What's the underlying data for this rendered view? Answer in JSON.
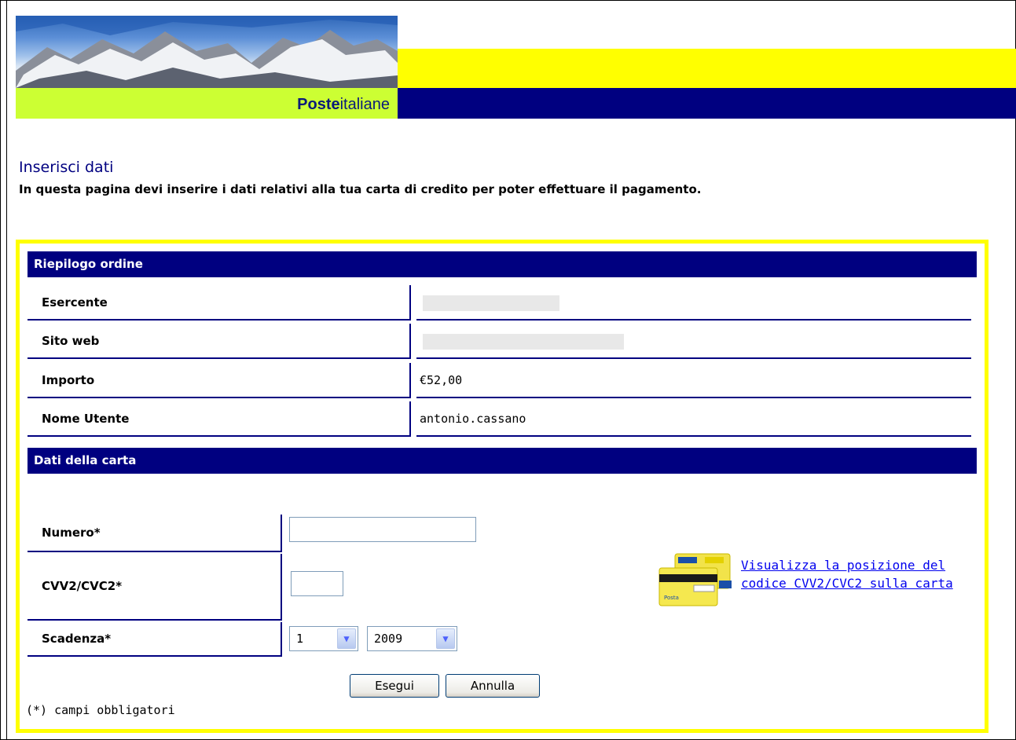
{
  "brand": {
    "bold": "Poste",
    "rest": "italiane"
  },
  "page": {
    "title": "Inserisci dati",
    "description": "In questa pagina devi inserire i dati relativi alla tua carta di credito per poter effettuare il pagamento."
  },
  "order_summary": {
    "heading": "Riepilogo ordine",
    "rows": [
      {
        "label": "Esercente",
        "value": ""
      },
      {
        "label": "Sito web",
        "value": ""
      },
      {
        "label": "Importo",
        "value": "€52,00"
      },
      {
        "label": "Nome Utente",
        "value": "antonio.cassano"
      }
    ]
  },
  "card": {
    "heading": "Dati della carta",
    "number_label": "Numero*",
    "number_value": "",
    "cvv_label": "CVV2/CVC2*",
    "cvv_value": "",
    "expiry_label": "Scadenza*",
    "expiry_month": "1",
    "expiry_year": "2009",
    "cvv_help_link": "Visualizza la posizione del codice CVV2/CVC2 sulla carta"
  },
  "actions": {
    "submit": "Esegui",
    "cancel": "Annulla"
  },
  "footnote": "(*) campi obbligatori",
  "colors": {
    "navy": "#000080",
    "yellow": "#ffff00",
    "lime": "#ccff33",
    "link": "#0000ee"
  }
}
